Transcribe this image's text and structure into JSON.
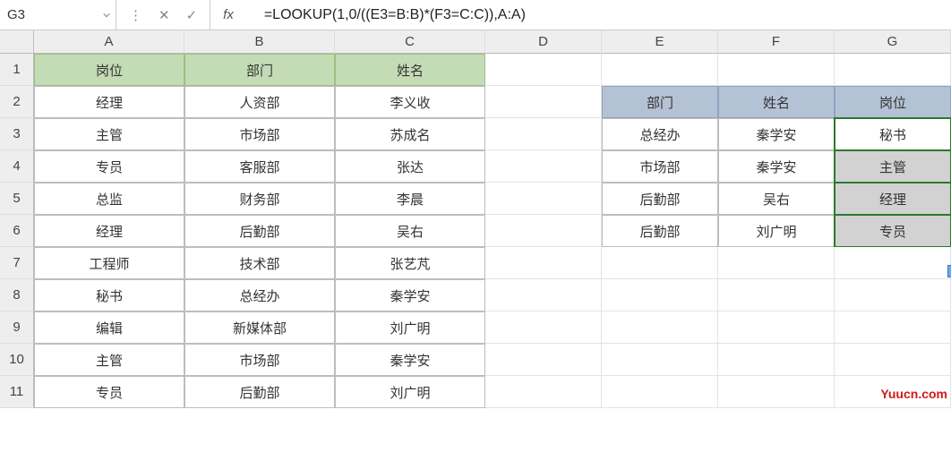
{
  "nameBox": "G3",
  "formula": "=LOOKUP(1,0/((E3=B:B)*(F3=C:C)),A:A)",
  "fxLabel": "fx",
  "columns": [
    "A",
    "B",
    "C",
    "D",
    "E",
    "F",
    "G"
  ],
  "rowNumbers": [
    "1",
    "2",
    "3",
    "4",
    "5",
    "6",
    "7",
    "8",
    "9",
    "10",
    "11"
  ],
  "leftHeaders": {
    "A": "岗位",
    "B": "部门",
    "C": "姓名"
  },
  "leftData": [
    {
      "A": "经理",
      "B": "人资部",
      "C": "李义收"
    },
    {
      "A": "主管",
      "B": "市场部",
      "C": "苏成名"
    },
    {
      "A": "专员",
      "B": "客服部",
      "C": "张达"
    },
    {
      "A": "总监",
      "B": "财务部",
      "C": "李晨"
    },
    {
      "A": "经理",
      "B": "后勤部",
      "C": "吴右"
    },
    {
      "A": "工程师",
      "B": "技术部",
      "C": "张艺芃"
    },
    {
      "A": "秘书",
      "B": "总经办",
      "C": "秦学安"
    },
    {
      "A": "编辑",
      "B": "新媒体部",
      "C": "刘广明"
    },
    {
      "A": "主管",
      "B": "市场部",
      "C": "秦学安"
    },
    {
      "A": "专员",
      "B": "后勤部",
      "C": "刘广明"
    }
  ],
  "rightHeaders": {
    "E": "部门",
    "F": "姓名",
    "G": "岗位"
  },
  "rightData": [
    {
      "E": "总经办",
      "F": "秦学安",
      "G": "秘书"
    },
    {
      "E": "市场部",
      "F": "秦学安",
      "G": "主管"
    },
    {
      "E": "后勤部",
      "F": "吴右",
      "G": "经理"
    },
    {
      "E": "后勤部",
      "F": "刘广明",
      "G": "专员"
    }
  ],
  "watermark": "Yuucn.com"
}
